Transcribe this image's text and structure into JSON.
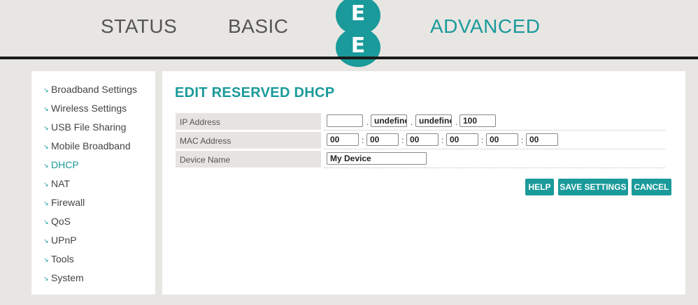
{
  "nav": {
    "status": "STATUS",
    "basic": "BASIC",
    "advanced": "ADVANCED",
    "logo_letters": [
      "E",
      "E"
    ]
  },
  "sidebar": {
    "items": [
      {
        "label": "Broadband Settings"
      },
      {
        "label": "Wireless Settings"
      },
      {
        "label": "USB File Sharing"
      },
      {
        "label": "Mobile Broadband"
      },
      {
        "label": "DHCP",
        "active": true
      },
      {
        "label": "NAT"
      },
      {
        "label": "Firewall"
      },
      {
        "label": "QoS"
      },
      {
        "label": "UPnP"
      },
      {
        "label": "Tools"
      },
      {
        "label": "System"
      }
    ]
  },
  "main": {
    "title": "EDIT RESERVED DHCP",
    "ip": {
      "label": "IP Address",
      "octets": [
        "",
        "undefined",
        "undefined",
        "100"
      ],
      "separator": "."
    },
    "mac": {
      "label": "MAC Address",
      "parts": [
        "00",
        "00",
        "00",
        "00",
        "00",
        "00"
      ],
      "separator": ":"
    },
    "device": {
      "label": "Device Name",
      "value": "My Device"
    },
    "buttons": {
      "help": "HELP",
      "save": "SAVE SETTINGS",
      "cancel": "CANCEL"
    }
  },
  "colors": {
    "accent": "#1a9a9a",
    "background": "#e8e6e3",
    "label_bg": "#e6e4e1"
  }
}
